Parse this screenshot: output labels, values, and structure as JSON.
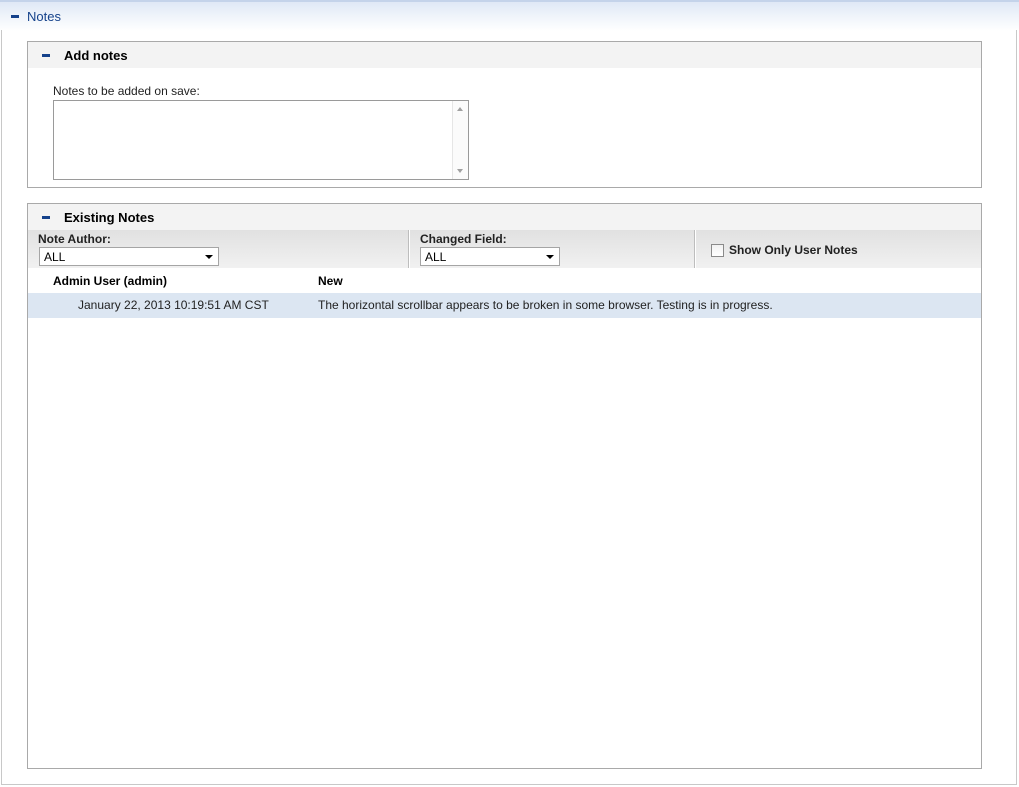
{
  "notes_section": {
    "title": "Notes"
  },
  "add_notes": {
    "title": "Add notes",
    "field_label": "Notes to be added on save:",
    "field_value": ""
  },
  "existing_notes": {
    "title": "Existing Notes",
    "filters": {
      "author_label": "Note Author:",
      "author_value": "ALL",
      "changed_field_label": "Changed Field:",
      "changed_field_value": "ALL",
      "show_user_only_label": "Show Only User Notes",
      "show_user_only_checked": false
    },
    "notes": [
      {
        "author": "Admin User (admin)",
        "change": "New",
        "timestamp": "January 22, 2013 10:19:51 AM CST",
        "text": "The horizontal scrollbar appears to be broken in some browser. Testing is in progress."
      }
    ]
  },
  "colors": {
    "accent": "#15428b",
    "row_highlight": "#dce6f2"
  }
}
